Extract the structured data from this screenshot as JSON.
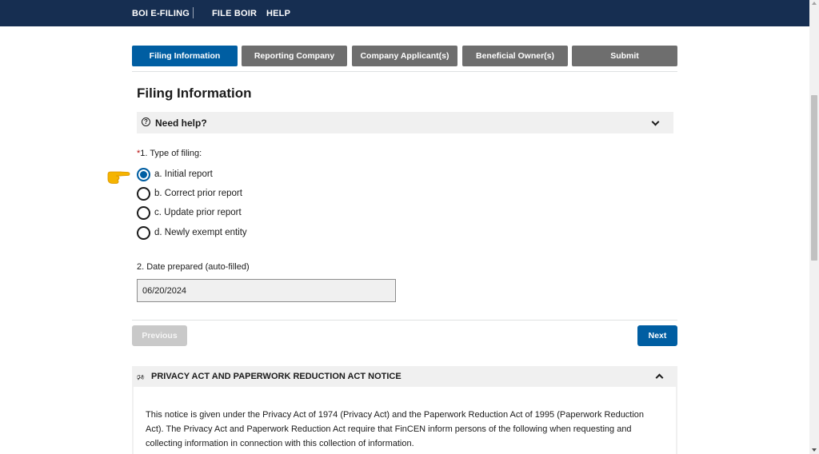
{
  "header": {
    "nav": [
      {
        "label": "BOI E-FILING"
      },
      {
        "label": "FILE BOIR"
      },
      {
        "label": "HELP"
      }
    ]
  },
  "steps": [
    {
      "label": "Filing Information",
      "active": true
    },
    {
      "label": "Reporting Company",
      "active": false
    },
    {
      "label": "Company Applicant(s)",
      "active": false
    },
    {
      "label": "Beneficial Owner(s)",
      "active": false
    },
    {
      "label": "Submit",
      "active": false
    }
  ],
  "main": {
    "title": "Filing Information",
    "help_label": "Need help?",
    "type_of_filing": {
      "required_mark": "*",
      "label": "1. Type of filing:",
      "options": [
        {
          "label": "a. Initial report",
          "selected": true
        },
        {
          "label": "b. Correct prior report",
          "selected": false
        },
        {
          "label": "c. Update prior report",
          "selected": false
        },
        {
          "label": "d. Newly exempt entity",
          "selected": false
        }
      ]
    },
    "date_prepared": {
      "label": "2. Date prepared (auto-filled)",
      "value": "06/20/2024"
    }
  },
  "buttons": {
    "previous": "Previous",
    "next": "Next"
  },
  "notice": {
    "title": "PRIVACY ACT AND PAPERWORK REDUCTION ACT NOTICE",
    "text": "This notice is given under the Privacy Act of 1974 (Privacy Act) and the Paperwork Reduction Act of 1995 (Paperwork Reduction Act). The Privacy Act and Paperwork Reduction Act require that FinCEN inform persons of the following when requesting and collecting information in connection with this collection of information."
  },
  "colors": {
    "header_bg": "#162e51",
    "active_tab": "#005ea2",
    "inactive_tab": "#6e6e6e",
    "required": "#b50909",
    "pointer": "#f5b400"
  }
}
